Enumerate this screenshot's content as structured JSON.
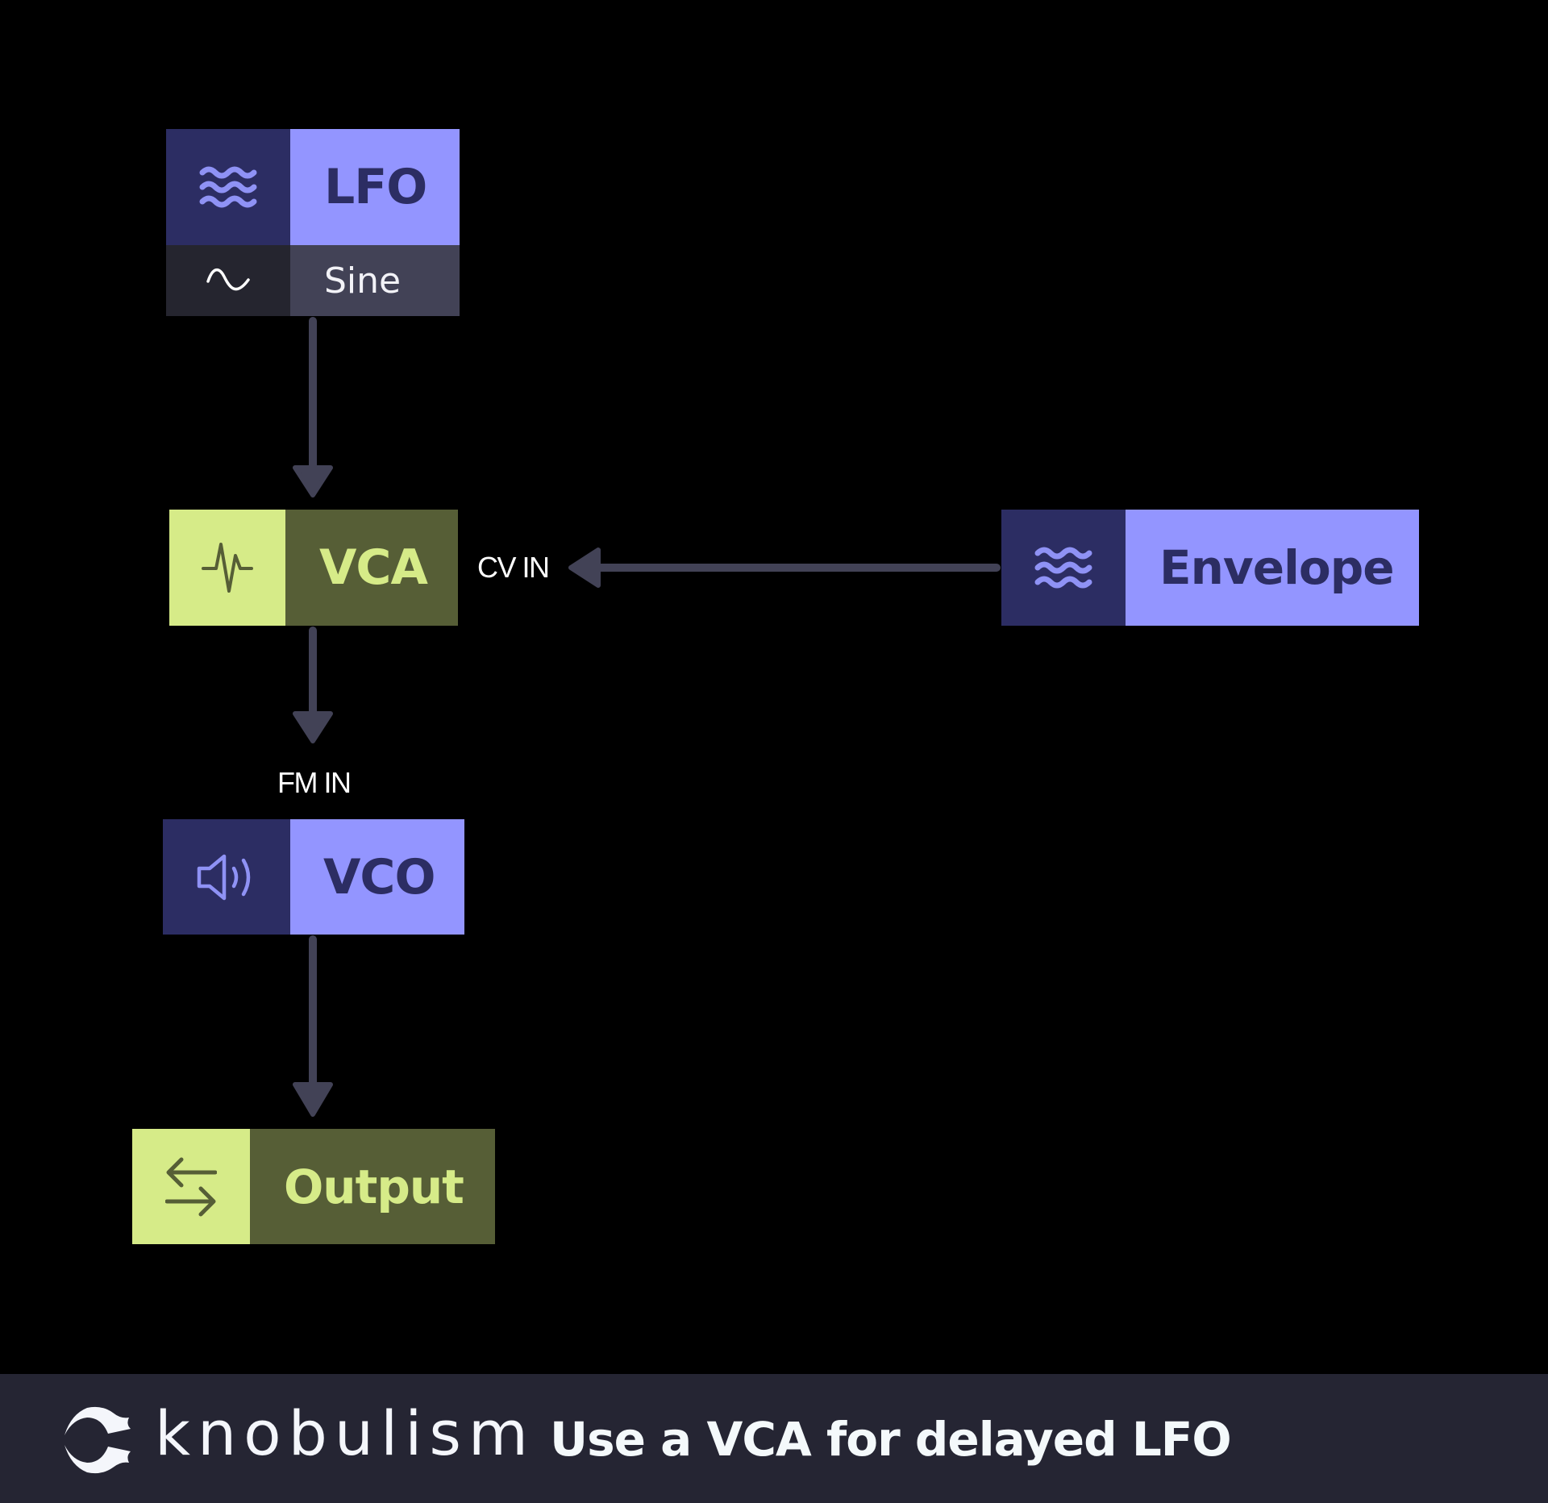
{
  "diagram": {
    "nodes": {
      "lfo": {
        "label": "LFO",
        "icon": "waves-icon",
        "sub_label": "Sine",
        "sub_icon": "sine-wave-icon"
      },
      "vca": {
        "label": "VCA",
        "icon": "pulse-icon"
      },
      "envelope": {
        "label": "Envelope",
        "icon": "waves-icon"
      },
      "vco": {
        "label": "VCO",
        "icon": "speaker-icon"
      },
      "output": {
        "label": "Output",
        "icon": "swap-arrows-icon"
      }
    },
    "edges": [
      {
        "from": "LFO",
        "to": "VCA",
        "port": ""
      },
      {
        "from": "Envelope",
        "to": "VCA",
        "port": "CV IN"
      },
      {
        "from": "VCA",
        "to": "VCO",
        "port": "FM IN"
      },
      {
        "from": "VCO",
        "to": "Output",
        "port": ""
      }
    ],
    "ports": {
      "cv_in": "CV IN",
      "fm_in": "FM IN"
    }
  },
  "footer": {
    "brand": "knobulism",
    "logo": "knob-logo-icon",
    "title": "Use a VCA for delayed LFO"
  },
  "colors": {
    "purple_dark": "#2c2d63",
    "purple_light": "#9395ff",
    "green_light": "#d6eb88",
    "green_dark": "#565e36",
    "wire": "#424256",
    "footer_bg": "#252533"
  }
}
